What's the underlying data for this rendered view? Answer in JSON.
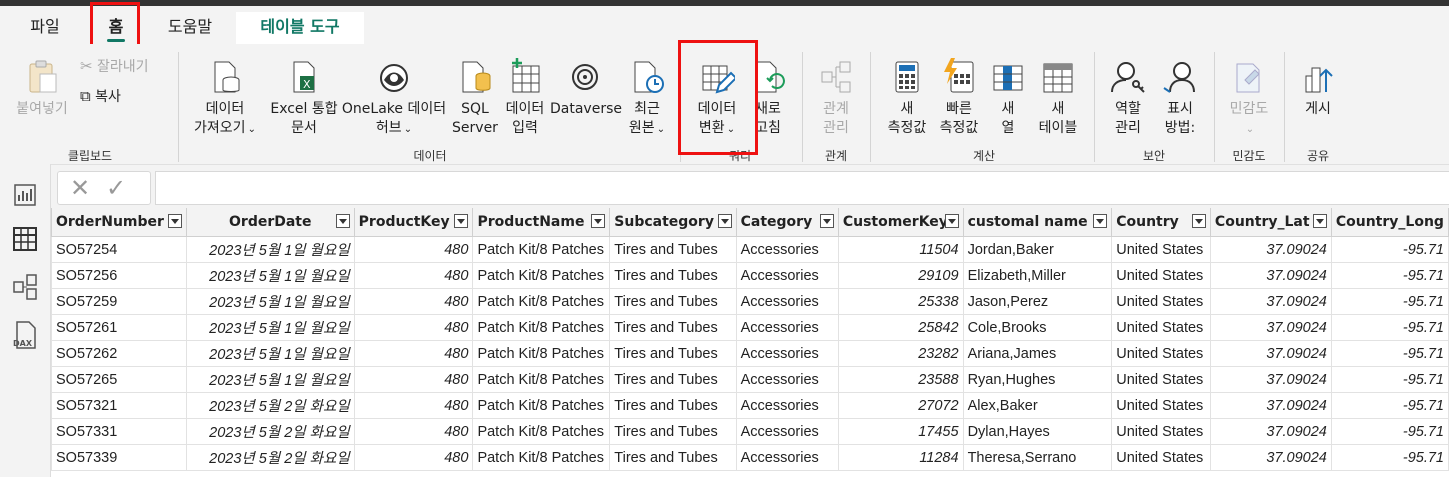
{
  "tabs": [
    "파일",
    "홈",
    "도움말",
    "테이블 도구"
  ],
  "clipboard": {
    "paste": "붙여넣기",
    "cut": "잘라내기",
    "copy": "복사",
    "group": "클립보드"
  },
  "data_group": {
    "get_data": [
      "데이터",
      "가져오기"
    ],
    "excel": [
      "Excel 통합",
      "문서"
    ],
    "onelake": [
      "OneLake 데이터",
      "허브"
    ],
    "sql": [
      "SQL",
      "Server"
    ],
    "enter_data": [
      "데이터",
      "입력"
    ],
    "dataverse": "Dataverse",
    "recent": [
      "최근",
      "원본"
    ],
    "group": "데이터"
  },
  "query_group": {
    "transform": [
      "데이터",
      "변환"
    ],
    "refresh": [
      "새로",
      "고침"
    ],
    "group": "쿼리"
  },
  "relations_group": {
    "manage": [
      "관계",
      "관리"
    ],
    "group": "관계"
  },
  "calc_group": {
    "new_measure": [
      "새",
      "측정값"
    ],
    "quick_measure": [
      "빠른",
      "측정값"
    ],
    "new_column": [
      "새",
      "열"
    ],
    "new_table": [
      "새",
      "테이블"
    ],
    "group": "계산"
  },
  "security_group": {
    "manage_roles": [
      "역할",
      "관리"
    ],
    "view_as": [
      "표시",
      "방법:"
    ],
    "group": "보안"
  },
  "sensitivity_group": {
    "label": "민감도",
    "group": "민감도"
  },
  "share_group": {
    "publish": "게시",
    "group": "공유"
  },
  "table": {
    "columns": [
      "OrderNumber",
      "OrderDate",
      "ProductKey",
      "ProductName",
      "Subcategory",
      "Category",
      "CustomerKey",
      "customal name",
      "Country",
      "Country_Lat",
      "Country_Long"
    ],
    "rows": [
      [
        "SO57254",
        "2023년 5월 1일 월요일",
        "480",
        "Patch Kit/8 Patches",
        "Tires and Tubes",
        "Accessories",
        "11504",
        "Jordan,Baker",
        "United States",
        "37.09024",
        "-95.71"
      ],
      [
        "SO57256",
        "2023년 5월 1일 월요일",
        "480",
        "Patch Kit/8 Patches",
        "Tires and Tubes",
        "Accessories",
        "29109",
        "Elizabeth,Miller",
        "United States",
        "37.09024",
        "-95.71"
      ],
      [
        "SO57259",
        "2023년 5월 1일 월요일",
        "480",
        "Patch Kit/8 Patches",
        "Tires and Tubes",
        "Accessories",
        "25338",
        "Jason,Perez",
        "United States",
        "37.09024",
        "-95.71"
      ],
      [
        "SO57261",
        "2023년 5월 1일 월요일",
        "480",
        "Patch Kit/8 Patches",
        "Tires and Tubes",
        "Accessories",
        "25842",
        "Cole,Brooks",
        "United States",
        "37.09024",
        "-95.71"
      ],
      [
        "SO57262",
        "2023년 5월 1일 월요일",
        "480",
        "Patch Kit/8 Patches",
        "Tires and Tubes",
        "Accessories",
        "23282",
        "Ariana,James",
        "United States",
        "37.09024",
        "-95.71"
      ],
      [
        "SO57265",
        "2023년 5월 1일 월요일",
        "480",
        "Patch Kit/8 Patches",
        "Tires and Tubes",
        "Accessories",
        "23588",
        "Ryan,Hughes",
        "United States",
        "37.09024",
        "-95.71"
      ],
      [
        "SO57321",
        "2023년 5월 2일 화요일",
        "480",
        "Patch Kit/8 Patches",
        "Tires and Tubes",
        "Accessories",
        "27072",
        "Alex,Baker",
        "United States",
        "37.09024",
        "-95.71"
      ],
      [
        "SO57331",
        "2023년 5월 2일 화요일",
        "480",
        "Patch Kit/8 Patches",
        "Tires and Tubes",
        "Accessories",
        "17455",
        "Dylan,Hayes",
        "United States",
        "37.09024",
        "-95.71"
      ],
      [
        "SO57339",
        "2023년 5월 2일 화요일",
        "480",
        "Patch Kit/8 Patches",
        "Tires and Tubes",
        "Accessories",
        "11284",
        "Theresa,Serrano",
        "United States",
        "37.09024",
        "-95.71"
      ]
    ]
  },
  "colors": {
    "accent": "#117865",
    "highlight": "#e11111"
  }
}
